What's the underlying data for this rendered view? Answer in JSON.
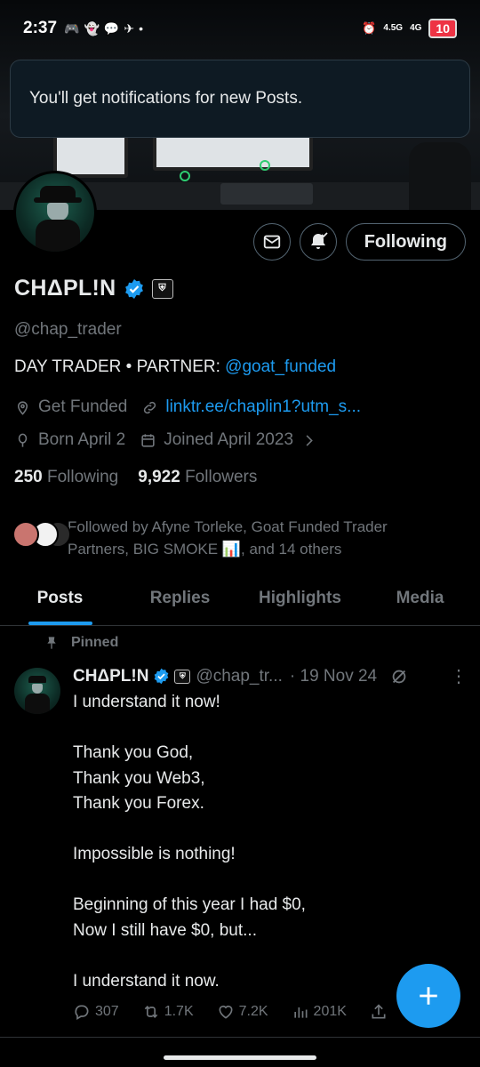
{
  "status_bar": {
    "time": "2:37",
    "left_icons": [
      "discord-icon",
      "snapchat-icon",
      "messenger-icon",
      "telegram-icon",
      "dot-icon"
    ],
    "network_top": "4.5G",
    "network_2": "4G",
    "battery": "10"
  },
  "toast": {
    "text": "You'll get notifications for new Posts."
  },
  "actions": {
    "following_label": "Following"
  },
  "profile": {
    "display_name": "CHΔPL!N",
    "handle": "@chap_trader",
    "bio_prefix": "DAY TRADER • PARTNER: ",
    "bio_mention": "@goat_funded",
    "location": "Get Funded",
    "website": "linktr.ee/chaplin1?utm_s...",
    "birthday": "Born April 2",
    "joined": "Joined April 2023",
    "following_count": "250",
    "following_label": "Following",
    "followers_count": "9,922",
    "followers_label": "Followers",
    "followed_by_line1": "Followed by Afyne Torleke, Goat Funded Trader",
    "followed_by_line2": "Partners, BIG SMOKE 📊, and 14 others"
  },
  "tabs": [
    {
      "label": "Posts",
      "active": true
    },
    {
      "label": "Replies",
      "active": false
    },
    {
      "label": "Highlights",
      "active": false
    },
    {
      "label": "Media",
      "active": false
    }
  ],
  "pinned": {
    "label": "Pinned"
  },
  "tweet": {
    "name": "CHΔPL!N",
    "handle": "@chap_tr...",
    "date": "· 19 Nov 24",
    "body": "I understand it now!\n\nThank you God,\nThank you Web3,\nThank you Forex.\n\nImpossible is nothing!\n\nBeginning of this year I had $0,\nNow I still have $0, but...\n\nI understand it now.",
    "replies": "307",
    "reposts": "1.7K",
    "likes": "7.2K",
    "views": "201K"
  },
  "colors": {
    "accent": "#1d9bf0",
    "muted": "#71767b",
    "text": "#e7e9ea",
    "background": "#000000"
  }
}
